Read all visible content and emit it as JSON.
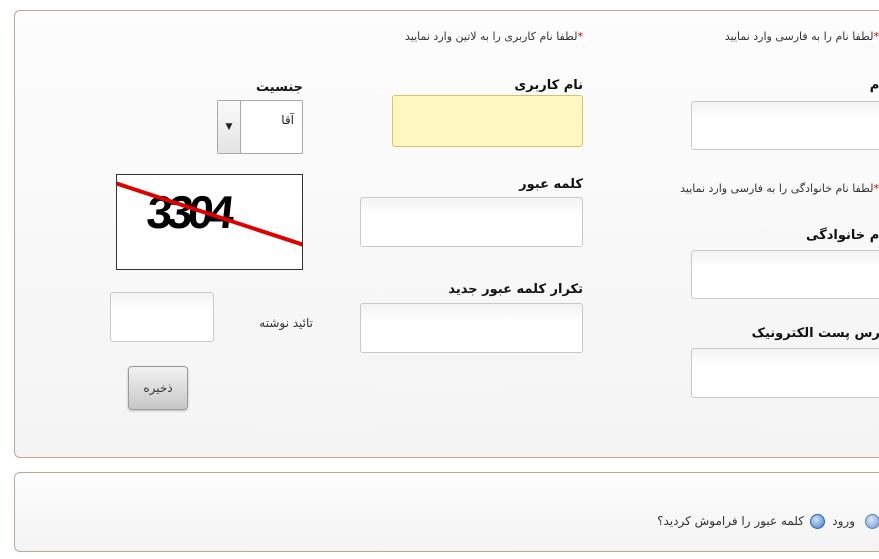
{
  "form": {
    "required_mark": "*",
    "first_name": {
      "hint": "لطفا نام را به فارسی وارد نمایید",
      "label": "نام"
    },
    "last_name": {
      "hint": "لطفا نام خانوادگی را به فارسی وارد نمایید",
      "label": "نام خانوادگی"
    },
    "email": {
      "label": "آدرس پست الکترونیک"
    },
    "username": {
      "hint": "لطفا نام کاربری را به لاتین وارد نمایید",
      "label": "نام کاربری"
    },
    "password": {
      "label": "کلمه عبور"
    },
    "password_repeat": {
      "label": "تکرار کلمه عبور جدید"
    },
    "gender": {
      "label": "جنسیت",
      "selected": "آقا"
    },
    "captcha": {
      "code": "3304",
      "confirm_label": "تائید نوشته"
    },
    "save_button": "ذخیره"
  },
  "links": {
    "login": "ورود",
    "forgot_password": "کلمه عبور را فراموش کردید؟"
  }
}
